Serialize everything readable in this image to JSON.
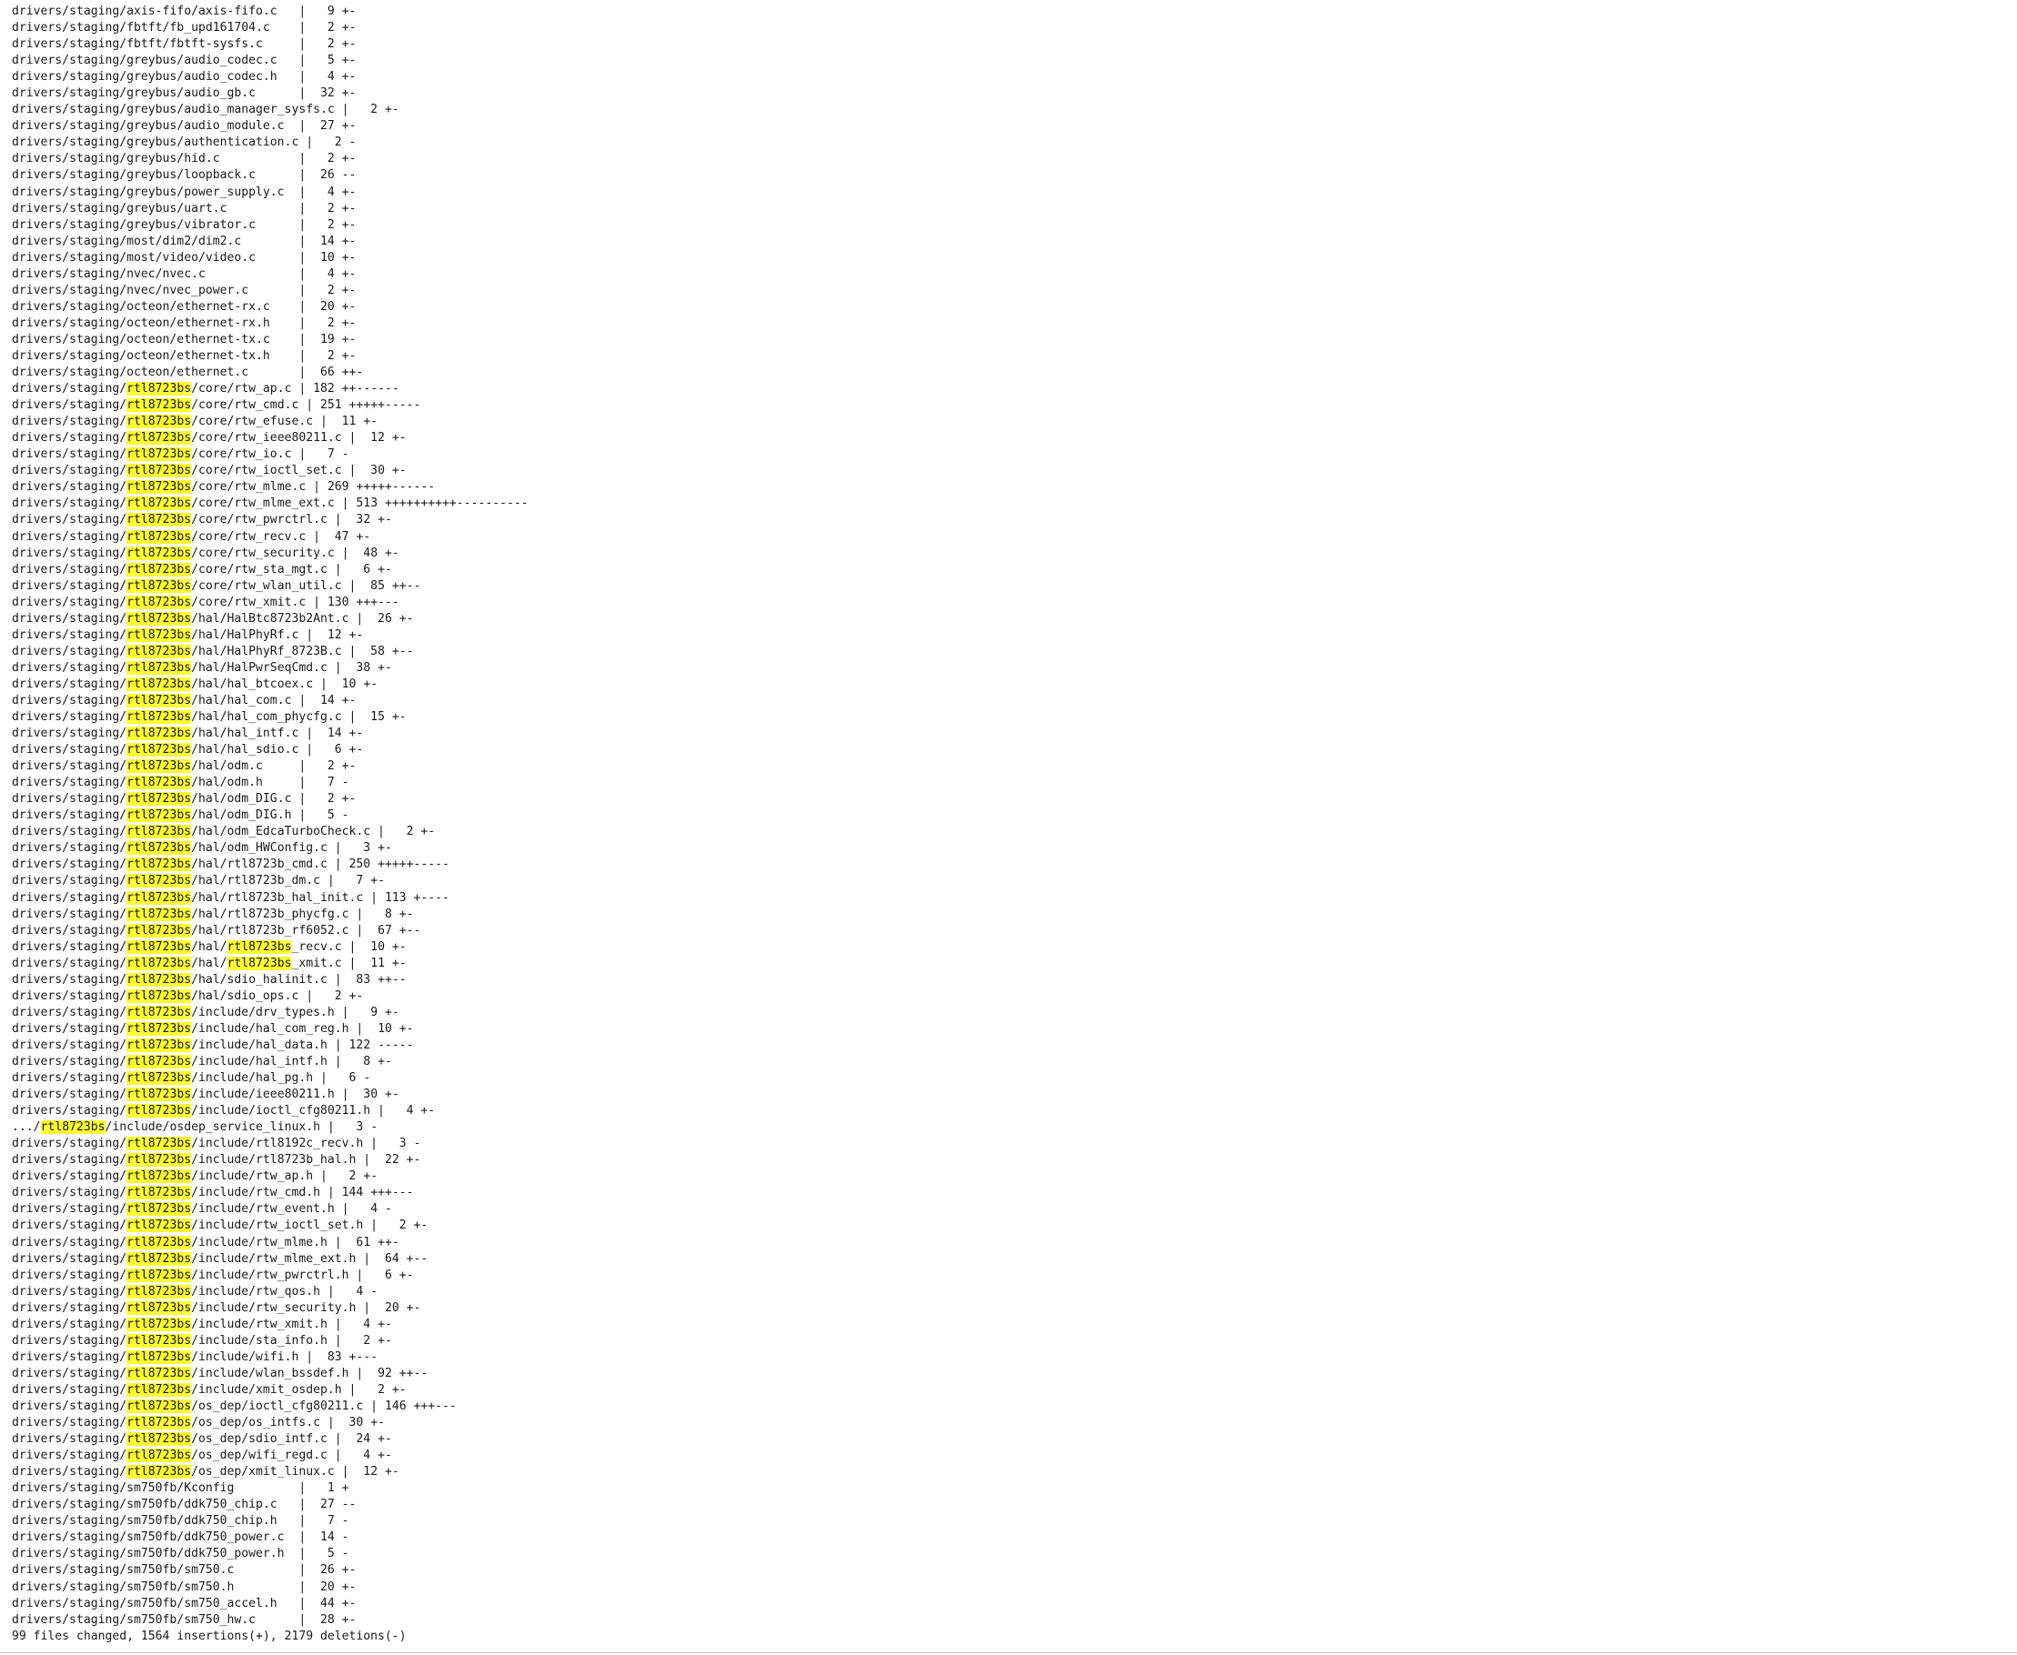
{
  "stat": {
    "highlight_term": "rtl8723bs",
    "name_width": 40,
    "rows": [
      {
        "path": "drivers/staging/axis-fifo/axis-fifo.c",
        "changes": "9",
        "graph": "+-"
      },
      {
        "path": "drivers/staging/fbtft/fb_upd161704.c",
        "changes": "2",
        "graph": "+-"
      },
      {
        "path": "drivers/staging/fbtft/fbtft-sysfs.c",
        "changes": "2",
        "graph": "+-"
      },
      {
        "path": "drivers/staging/greybus/audio_codec.c",
        "changes": "5",
        "graph": "+-"
      },
      {
        "path": "drivers/staging/greybus/audio_codec.h",
        "changes": "4",
        "graph": "+-"
      },
      {
        "path": "drivers/staging/greybus/audio_gb.c",
        "changes": "32",
        "graph": "+-"
      },
      {
        "path": "drivers/staging/greybus/audio_manager_sysfs.c",
        "changes": "2",
        "graph": "+-"
      },
      {
        "path": "drivers/staging/greybus/audio_module.c",
        "changes": "27",
        "graph": "+-"
      },
      {
        "path": "drivers/staging/greybus/authentication.c",
        "changes": "2",
        "graph": "-"
      },
      {
        "path": "drivers/staging/greybus/hid.c",
        "changes": "2",
        "graph": "+-"
      },
      {
        "path": "drivers/staging/greybus/loopback.c",
        "changes": "26",
        "graph": "--"
      },
      {
        "path": "drivers/staging/greybus/power_supply.c",
        "changes": "4",
        "graph": "+-"
      },
      {
        "path": "drivers/staging/greybus/uart.c",
        "changes": "2",
        "graph": "+-"
      },
      {
        "path": "drivers/staging/greybus/vibrator.c",
        "changes": "2",
        "graph": "+-"
      },
      {
        "path": "drivers/staging/most/dim2/dim2.c",
        "changes": "14",
        "graph": "+-"
      },
      {
        "path": "drivers/staging/most/video/video.c",
        "changes": "10",
        "graph": "+-"
      },
      {
        "path": "drivers/staging/nvec/nvec.c",
        "changes": "4",
        "graph": "+-"
      },
      {
        "path": "drivers/staging/nvec/nvec_power.c",
        "changes": "2",
        "graph": "+-"
      },
      {
        "path": "drivers/staging/octeon/ethernet-rx.c",
        "changes": "20",
        "graph": "+-"
      },
      {
        "path": "drivers/staging/octeon/ethernet-rx.h",
        "changes": "2",
        "graph": "+-"
      },
      {
        "path": "drivers/staging/octeon/ethernet-tx.c",
        "changes": "19",
        "graph": "+-"
      },
      {
        "path": "drivers/staging/octeon/ethernet-tx.h",
        "changes": "2",
        "graph": "+-"
      },
      {
        "path": "drivers/staging/octeon/ethernet.c",
        "changes": "66",
        "graph": "++-"
      },
      {
        "path": "drivers/staging/rtl8723bs/core/rtw_ap.c",
        "changes": "182",
        "graph": "++------"
      },
      {
        "path": "drivers/staging/rtl8723bs/core/rtw_cmd.c",
        "changes": "251",
        "graph": "+++++-----"
      },
      {
        "path": "drivers/staging/rtl8723bs/core/rtw_efuse.c",
        "changes": "11",
        "graph": "+-"
      },
      {
        "path": "drivers/staging/rtl8723bs/core/rtw_ieee80211.c",
        "changes": "12",
        "graph": "+-"
      },
      {
        "path": "drivers/staging/rtl8723bs/core/rtw_io.c",
        "changes": "7",
        "graph": "-"
      },
      {
        "path": "drivers/staging/rtl8723bs/core/rtw_ioctl_set.c",
        "changes": "30",
        "graph": "+-"
      },
      {
        "path": "drivers/staging/rtl8723bs/core/rtw_mlme.c",
        "changes": "269",
        "graph": "+++++------"
      },
      {
        "path": "drivers/staging/rtl8723bs/core/rtw_mlme_ext.c",
        "changes": "513",
        "graph": "++++++++++----------"
      },
      {
        "path": "drivers/staging/rtl8723bs/core/rtw_pwrctrl.c",
        "changes": "32",
        "graph": "+-"
      },
      {
        "path": "drivers/staging/rtl8723bs/core/rtw_recv.c",
        "changes": "47",
        "graph": "+-"
      },
      {
        "path": "drivers/staging/rtl8723bs/core/rtw_security.c",
        "changes": "48",
        "graph": "+-"
      },
      {
        "path": "drivers/staging/rtl8723bs/core/rtw_sta_mgt.c",
        "changes": "6",
        "graph": "+-"
      },
      {
        "path": "drivers/staging/rtl8723bs/core/rtw_wlan_util.c",
        "changes": "85",
        "graph": "++--"
      },
      {
        "path": "drivers/staging/rtl8723bs/core/rtw_xmit.c",
        "changes": "130",
        "graph": "+++---"
      },
      {
        "path": "drivers/staging/rtl8723bs/hal/HalBtc8723b2Ant.c",
        "changes": "26",
        "graph": "+-"
      },
      {
        "path": "drivers/staging/rtl8723bs/hal/HalPhyRf.c",
        "changes": "12",
        "graph": "+-"
      },
      {
        "path": "drivers/staging/rtl8723bs/hal/HalPhyRf_8723B.c",
        "changes": "58",
        "graph": "+--"
      },
      {
        "path": "drivers/staging/rtl8723bs/hal/HalPwrSeqCmd.c",
        "changes": "38",
        "graph": "+-"
      },
      {
        "path": "drivers/staging/rtl8723bs/hal/hal_btcoex.c",
        "changes": "10",
        "graph": "+-"
      },
      {
        "path": "drivers/staging/rtl8723bs/hal/hal_com.c",
        "changes": "14",
        "graph": "+-"
      },
      {
        "path": "drivers/staging/rtl8723bs/hal/hal_com_phycfg.c",
        "changes": "15",
        "graph": "+-"
      },
      {
        "path": "drivers/staging/rtl8723bs/hal/hal_intf.c",
        "changes": "14",
        "graph": "+-"
      },
      {
        "path": "drivers/staging/rtl8723bs/hal/hal_sdio.c",
        "changes": "6",
        "graph": "+-"
      },
      {
        "path": "drivers/staging/rtl8723bs/hal/odm.c",
        "changes": "2",
        "graph": "+-"
      },
      {
        "path": "drivers/staging/rtl8723bs/hal/odm.h",
        "changes": "7",
        "graph": "-"
      },
      {
        "path": "drivers/staging/rtl8723bs/hal/odm_DIG.c",
        "changes": "2",
        "graph": "+-"
      },
      {
        "path": "drivers/staging/rtl8723bs/hal/odm_DIG.h",
        "changes": "5",
        "graph": "-"
      },
      {
        "path": "drivers/staging/rtl8723bs/hal/odm_EdcaTurboCheck.c",
        "changes": "2",
        "graph": "+-"
      },
      {
        "path": "drivers/staging/rtl8723bs/hal/odm_HWConfig.c",
        "changes": "3",
        "graph": "+-"
      },
      {
        "path": "drivers/staging/rtl8723bs/hal/rtl8723b_cmd.c",
        "changes": "250",
        "graph": "+++++-----"
      },
      {
        "path": "drivers/staging/rtl8723bs/hal/rtl8723b_dm.c",
        "changes": "7",
        "graph": "+-"
      },
      {
        "path": "drivers/staging/rtl8723bs/hal/rtl8723b_hal_init.c",
        "changes": "113",
        "graph": "+----"
      },
      {
        "path": "drivers/staging/rtl8723bs/hal/rtl8723b_phycfg.c",
        "changes": "8",
        "graph": "+-"
      },
      {
        "path": "drivers/staging/rtl8723bs/hal/rtl8723b_rf6052.c",
        "changes": "67",
        "graph": "+--"
      },
      {
        "path": "drivers/staging/rtl8723bs/hal/rtl8723bs_recv.c",
        "changes": "10",
        "graph": "+-"
      },
      {
        "path": "drivers/staging/rtl8723bs/hal/rtl8723bs_xmit.c",
        "changes": "11",
        "graph": "+-"
      },
      {
        "path": "drivers/staging/rtl8723bs/hal/sdio_halinit.c",
        "changes": "83",
        "graph": "++--"
      },
      {
        "path": "drivers/staging/rtl8723bs/hal/sdio_ops.c",
        "changes": "2",
        "graph": "+-"
      },
      {
        "path": "drivers/staging/rtl8723bs/include/drv_types.h",
        "changes": "9",
        "graph": "+-"
      },
      {
        "path": "drivers/staging/rtl8723bs/include/hal_com_reg.h",
        "changes": "10",
        "graph": "+-"
      },
      {
        "path": "drivers/staging/rtl8723bs/include/hal_data.h",
        "changes": "122",
        "graph": "-----"
      },
      {
        "path": "drivers/staging/rtl8723bs/include/hal_intf.h",
        "changes": "8",
        "graph": "+-"
      },
      {
        "path": "drivers/staging/rtl8723bs/include/hal_pg.h",
        "changes": "6",
        "graph": "-"
      },
      {
        "path": "drivers/staging/rtl8723bs/include/ieee80211.h",
        "changes": "30",
        "graph": "+-"
      },
      {
        "path": "drivers/staging/rtl8723bs/include/ioctl_cfg80211.h",
        "changes": "4",
        "graph": "+-"
      },
      {
        "path": ".../rtl8723bs/include/osdep_service_linux.h",
        "changes": "3",
        "graph": "-"
      },
      {
        "path": "drivers/staging/rtl8723bs/include/rtl8192c_recv.h",
        "changes": "3",
        "graph": "-"
      },
      {
        "path": "drivers/staging/rtl8723bs/include/rtl8723b_hal.h",
        "changes": "22",
        "graph": "+-"
      },
      {
        "path": "drivers/staging/rtl8723bs/include/rtw_ap.h",
        "changes": "2",
        "graph": "+-"
      },
      {
        "path": "drivers/staging/rtl8723bs/include/rtw_cmd.h",
        "changes": "144",
        "graph": "+++---"
      },
      {
        "path": "drivers/staging/rtl8723bs/include/rtw_event.h",
        "changes": "4",
        "graph": "-"
      },
      {
        "path": "drivers/staging/rtl8723bs/include/rtw_ioctl_set.h",
        "changes": "2",
        "graph": "+-"
      },
      {
        "path": "drivers/staging/rtl8723bs/include/rtw_mlme.h",
        "changes": "61",
        "graph": "++-"
      },
      {
        "path": "drivers/staging/rtl8723bs/include/rtw_mlme_ext.h",
        "changes": "64",
        "graph": "+--"
      },
      {
        "path": "drivers/staging/rtl8723bs/include/rtw_pwrctrl.h",
        "changes": "6",
        "graph": "+-"
      },
      {
        "path": "drivers/staging/rtl8723bs/include/rtw_qos.h",
        "changes": "4",
        "graph": "-"
      },
      {
        "path": "drivers/staging/rtl8723bs/include/rtw_security.h",
        "changes": "20",
        "graph": "+-"
      },
      {
        "path": "drivers/staging/rtl8723bs/include/rtw_xmit.h",
        "changes": "4",
        "graph": "+-"
      },
      {
        "path": "drivers/staging/rtl8723bs/include/sta_info.h",
        "changes": "2",
        "graph": "+-"
      },
      {
        "path": "drivers/staging/rtl8723bs/include/wifi.h",
        "changes": "83",
        "graph": "+---"
      },
      {
        "path": "drivers/staging/rtl8723bs/include/wlan_bssdef.h",
        "changes": "92",
        "graph": "++--"
      },
      {
        "path": "drivers/staging/rtl8723bs/include/xmit_osdep.h",
        "changes": "2",
        "graph": "+-"
      },
      {
        "path": "drivers/staging/rtl8723bs/os_dep/ioctl_cfg80211.c",
        "changes": "146",
        "graph": "+++---"
      },
      {
        "path": "drivers/staging/rtl8723bs/os_dep/os_intfs.c",
        "changes": "30",
        "graph": "+-"
      },
      {
        "path": "drivers/staging/rtl8723bs/os_dep/sdio_intf.c",
        "changes": "24",
        "graph": "+-"
      },
      {
        "path": "drivers/staging/rtl8723bs/os_dep/wifi_regd.c",
        "changes": "4",
        "graph": "+-"
      },
      {
        "path": "drivers/staging/rtl8723bs/os_dep/xmit_linux.c",
        "changes": "12",
        "graph": "+-"
      },
      {
        "path": "drivers/staging/sm750fb/Kconfig",
        "changes": "1",
        "graph": "+"
      },
      {
        "path": "drivers/staging/sm750fb/ddk750_chip.c",
        "changes": "27",
        "graph": "--"
      },
      {
        "path": "drivers/staging/sm750fb/ddk750_chip.h",
        "changes": "7",
        "graph": "-"
      },
      {
        "path": "drivers/staging/sm750fb/ddk750_power.c",
        "changes": "14",
        "graph": "-"
      },
      {
        "path": "drivers/staging/sm750fb/ddk750_power.h",
        "changes": "5",
        "graph": "-"
      },
      {
        "path": "drivers/staging/sm750fb/sm750.c",
        "changes": "26",
        "graph": "+-"
      },
      {
        "path": "drivers/staging/sm750fb/sm750.h",
        "changes": "20",
        "graph": "+-"
      },
      {
        "path": "drivers/staging/sm750fb/sm750_accel.h",
        "changes": "44",
        "graph": "+-"
      },
      {
        "path": "drivers/staging/sm750fb/sm750_hw.c",
        "changes": "28",
        "graph": "+-"
      }
    ],
    "summary": "99 files changed, 1564 insertions(+), 2179 deletions(-)"
  }
}
